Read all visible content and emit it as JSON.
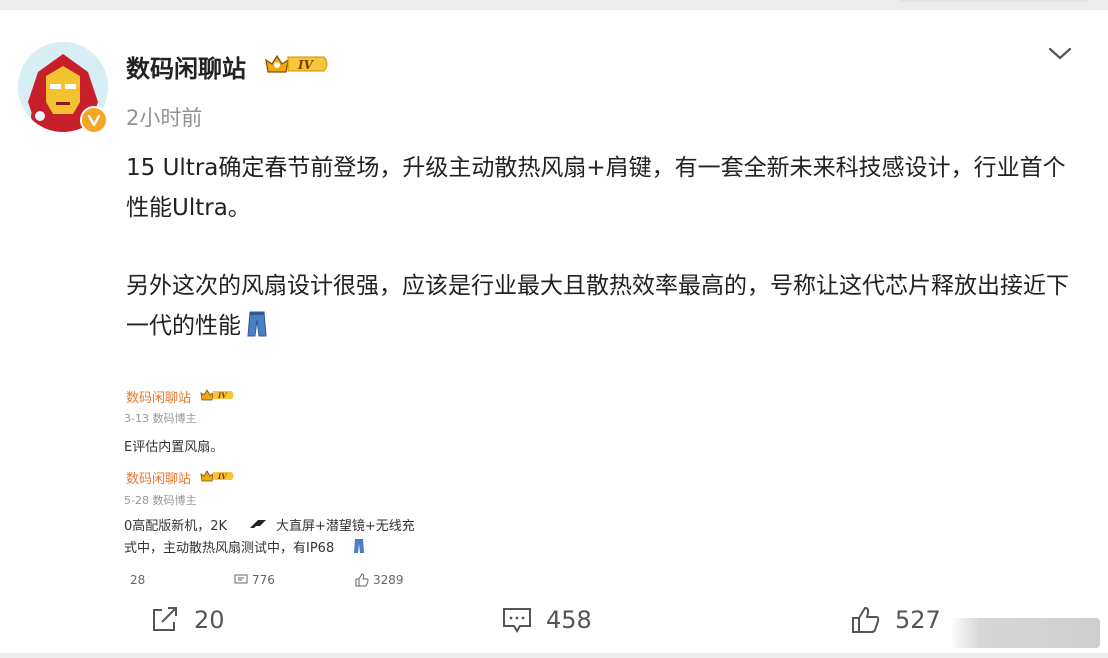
{
  "author": {
    "name": "数码闲聊站",
    "level": "IV",
    "time": "2小时前"
  },
  "post": {
    "paragraph1": "15 Ultra确定春节前登场，升级主动散热风扇+肩键，有一套全新未来科技感设计，行业首个性能Ultra。",
    "paragraph2": "另外这次的风扇设计很强，应该是行业最大且散热效率最高的，号称让这代芯片释放出接近下一代的性能"
  },
  "embed": {
    "posts": [
      {
        "name": "数码闲聊站",
        "level": "IV",
        "meta": "3-13  数码博主",
        "lines": [
          "E评估内置风扇。"
        ]
      },
      {
        "name": "数码闲聊站",
        "level": "IV",
        "meta": "5-28  数码博主",
        "lines": [
          "0高配版新机，2K",
          "大直屏+潜望镜+无线充",
          "式中，主动散热风扇测试中，有IP68"
        ]
      }
    ],
    "stats": {
      "reposts": "28",
      "comments": "776",
      "likes": "3289"
    }
  },
  "actions": {
    "reposts": "20",
    "comments": "458",
    "likes": "527"
  },
  "colors": {
    "accent": "#e8772e",
    "badge": "#f5a623",
    "text": "#222222",
    "muted": "#939393"
  }
}
